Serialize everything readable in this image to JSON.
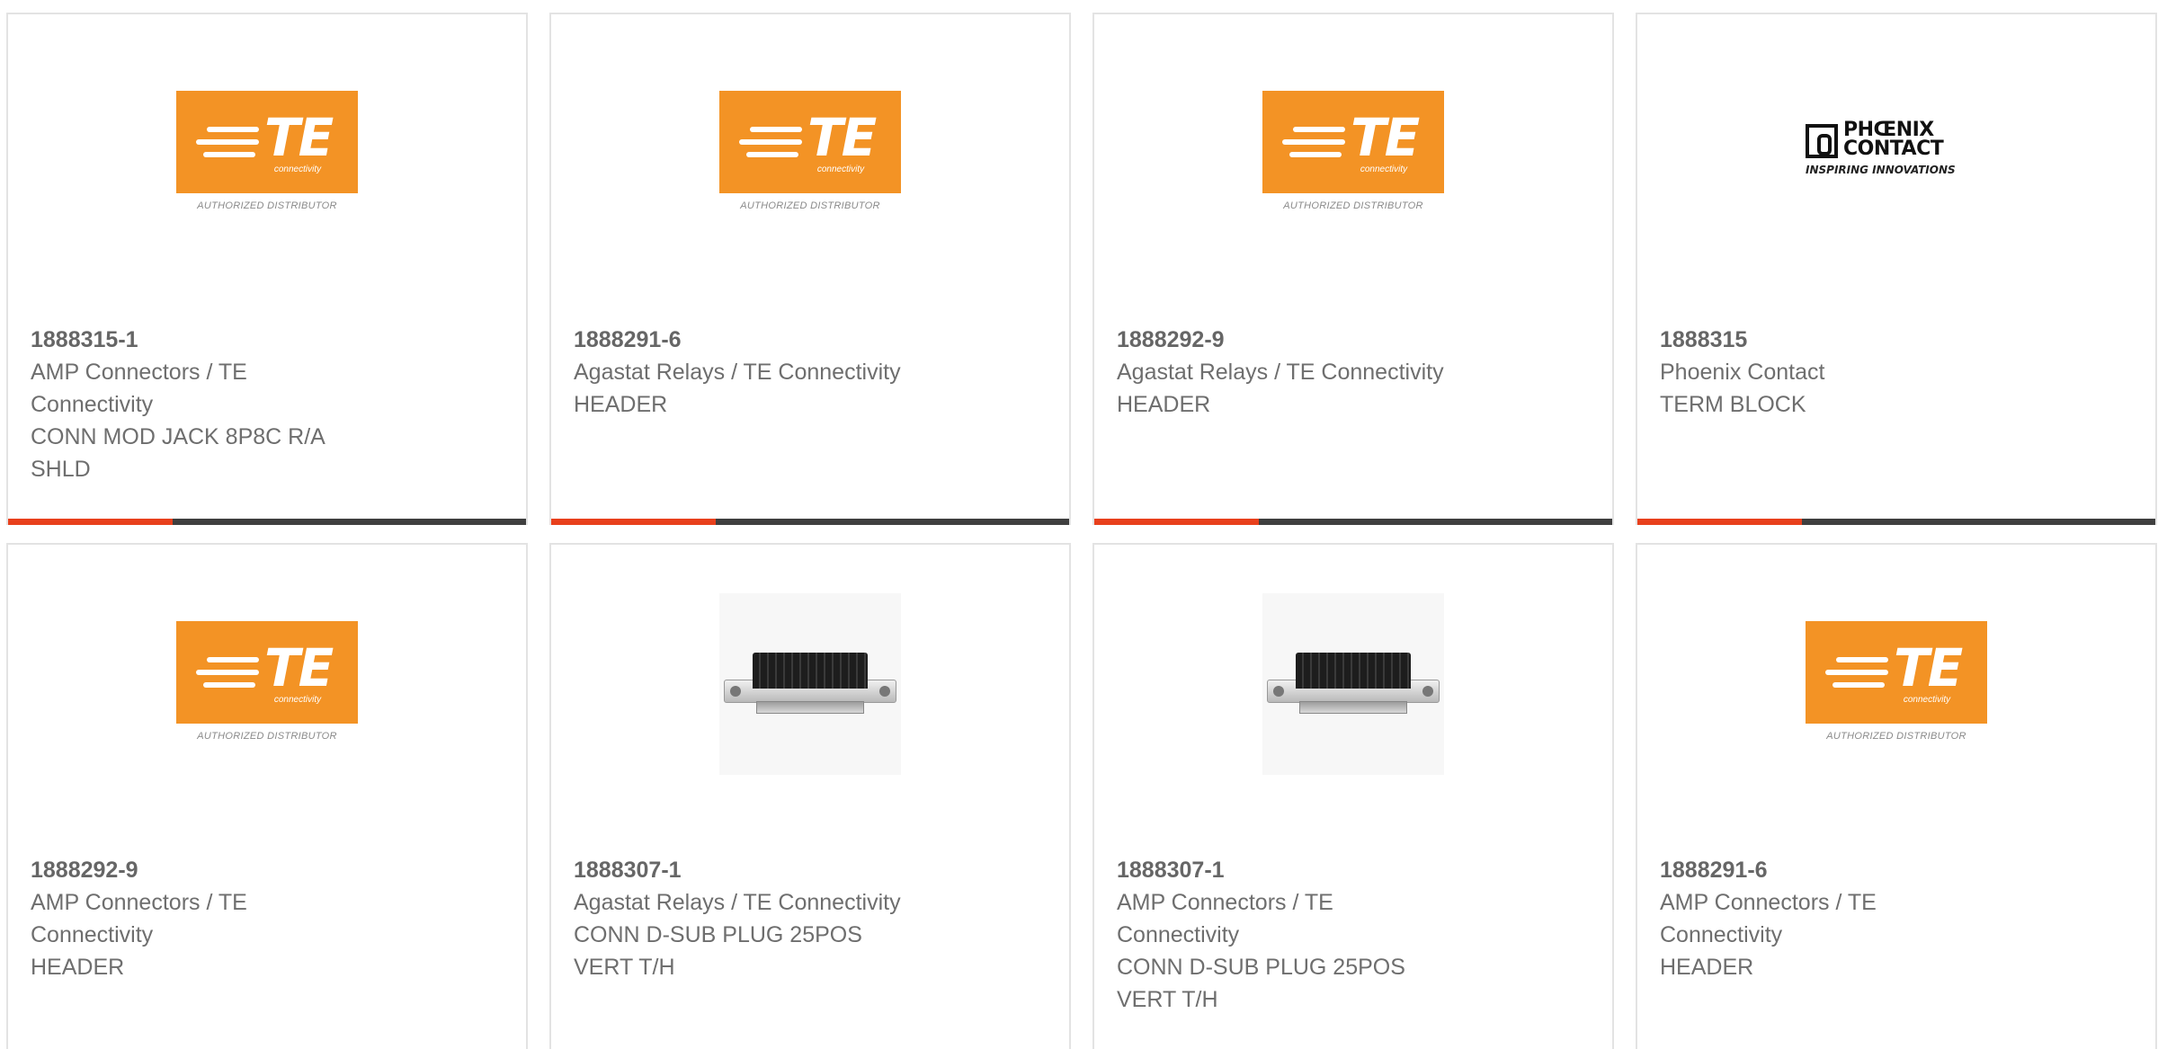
{
  "colors": {
    "accent": "#e8401c",
    "bar": "#3f3f3f",
    "te_orange": "#f39325",
    "text": "#6e6e6e"
  },
  "logos": {
    "te": {
      "word": "TE",
      "sub": "connectivity",
      "tag": "AUTHORIZED DISTRIBUTOR"
    },
    "phoenix": {
      "name_line1": "PHŒNIX",
      "name_line2": "CONTACT",
      "tag": "INSPIRING INNOVATIONS"
    }
  },
  "products": [
    {
      "image": "te-logo",
      "part": "1888315-1",
      "lines": [
        "AMP Connectors / TE",
        "Connectivity",
        "CONN MOD JACK 8P8C R/A",
        "SHLD"
      ]
    },
    {
      "image": "te-logo",
      "part": "1888291-6",
      "lines": [
        "Agastat Relays / TE Connectivity",
        "HEADER"
      ]
    },
    {
      "image": "te-logo",
      "part": "1888292-9",
      "lines": [
        "Agastat Relays / TE Connectivity",
        "HEADER"
      ]
    },
    {
      "image": "phoenix-logo",
      "part": "1888315",
      "lines": [
        "Phoenix Contact",
        "TERM BLOCK"
      ]
    },
    {
      "image": "te-logo",
      "part": "1888292-9",
      "lines": [
        "AMP Connectors / TE",
        "Connectivity",
        "HEADER"
      ]
    },
    {
      "image": "dsub-connector",
      "part": "1888307-1",
      "lines": [
        "Agastat Relays / TE Connectivity",
        "CONN D-SUB PLUG 25POS",
        "VERT T/H"
      ]
    },
    {
      "image": "dsub-connector",
      "part": "1888307-1",
      "lines": [
        "AMP Connectors / TE",
        "Connectivity",
        "CONN D-SUB PLUG 25POS",
        "VERT T/H"
      ]
    },
    {
      "image": "te-logo",
      "part": "1888291-6",
      "lines": [
        "AMP Connectors / TE",
        "Connectivity",
        "HEADER"
      ]
    }
  ]
}
